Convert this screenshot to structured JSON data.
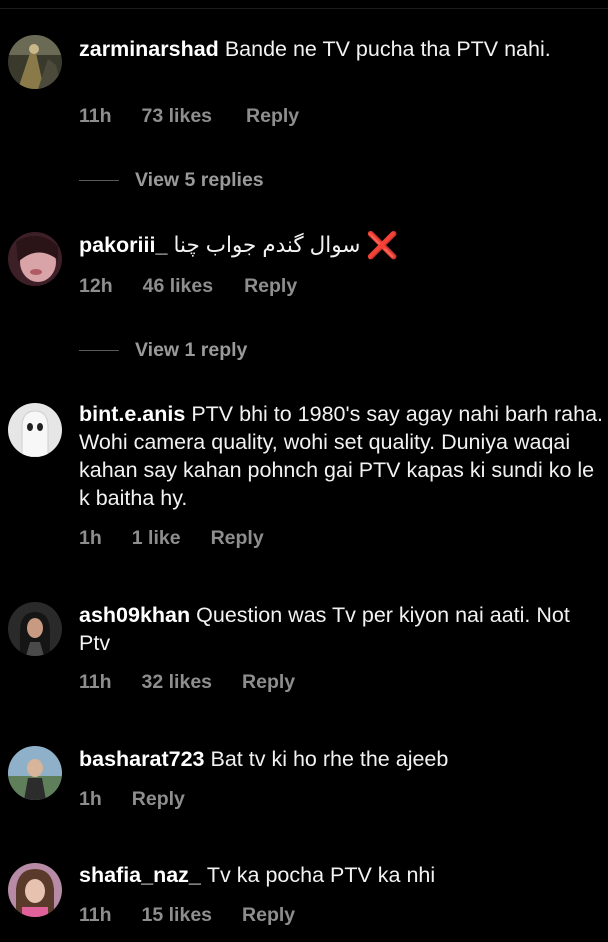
{
  "comments": [
    {
      "username": "zarminarshad",
      "text": "Bande ne TV pucha tha PTV nahi.",
      "time": "11h",
      "likes": "73 likes",
      "reply": "Reply",
      "view_replies": "View 5 replies",
      "avatar_icon": "avatar-photo"
    },
    {
      "username": "pakoriii_",
      "text": "سوال گندم جواب چنا",
      "emoji": "❌",
      "time": "12h",
      "likes": "46 likes",
      "reply": "Reply",
      "view_replies": "View 1 reply",
      "avatar_icon": "avatar-photo"
    },
    {
      "username": "bint.e.anis",
      "text": "PTV  bhi to 1980's say agay nahi barh raha. Wohi camera quality, wohi set quality. Duniya waqai kahan say kahan pohnch gai PTV kapas ki sundi ko le k baitha hy.",
      "time": "1h",
      "likes": "1 like",
      "reply": "Reply",
      "avatar_icon": "ghost-avatar"
    },
    {
      "username": "ash09khan",
      "text": "Question was Tv per kiyon nai aati. Not Ptv",
      "time": "11h",
      "likes": "32 likes",
      "reply": "Reply",
      "avatar_icon": "avatar-photo"
    },
    {
      "username": "basharat723",
      "text": "Bat tv ki ho rhe the ajeeb",
      "time": "1h",
      "reply": "Reply",
      "avatar_icon": "avatar-photo"
    },
    {
      "username": "shafia_naz_",
      "text": "Tv ka pocha PTV ka nhi",
      "time": "11h",
      "likes": "15 likes",
      "reply": "Reply",
      "avatar_icon": "avatar-photo"
    }
  ],
  "colors": {
    "background": "#000000",
    "text": "#f2f2f2",
    "meta": "#8e8e8e",
    "cross": "#e8262b"
  }
}
